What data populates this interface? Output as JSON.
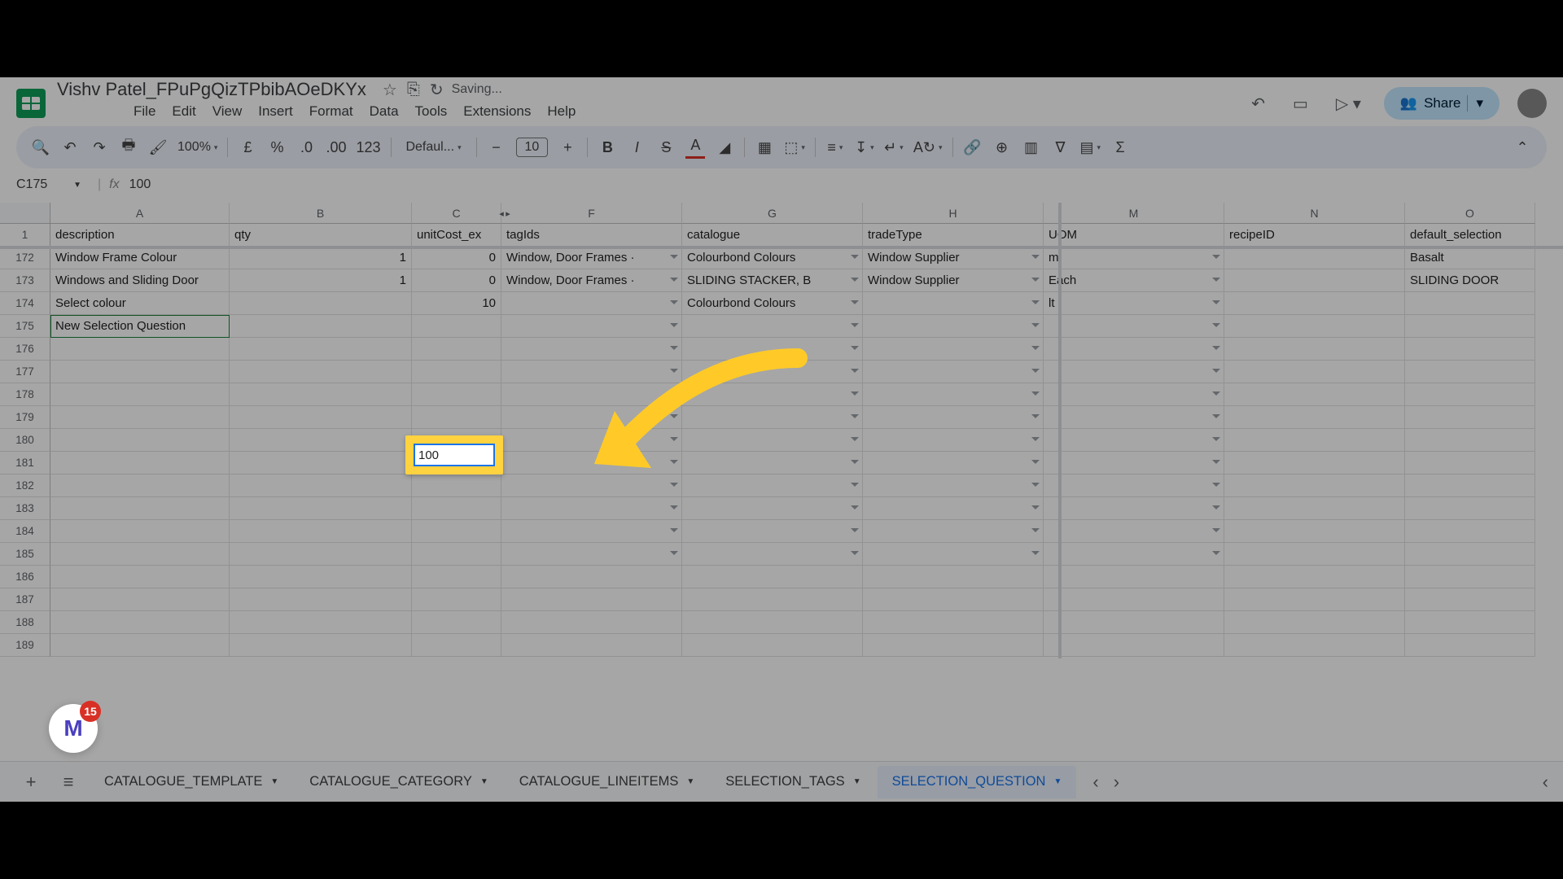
{
  "doc": {
    "title": "Vishv Patel_FPuPgQizTPbibAOeDKYx",
    "saving": "Saving...",
    "share": "Share"
  },
  "menu": [
    "File",
    "Edit",
    "View",
    "Insert",
    "Format",
    "Data",
    "Tools",
    "Extensions",
    "Help"
  ],
  "toolbar": {
    "zoom": "100%",
    "currency": "£",
    "font": "Defaul...",
    "size": "10"
  },
  "namebox": "C175",
  "formula": "100",
  "columns": {
    "A": "description",
    "B": "qty",
    "C": "unitCost_ex",
    "F": "tagIds",
    "G": "catalogue",
    "H": "tradeType",
    "M": "UOM",
    "N": "recipeID",
    "O": "default_selection"
  },
  "col_letters": [
    "A",
    "B",
    "C",
    "F",
    "G",
    "H",
    "M",
    "N",
    "O"
  ],
  "row_numbers": [
    "1",
    "172",
    "173",
    "174",
    "175",
    "176",
    "177",
    "178",
    "179",
    "180",
    "181",
    "182",
    "183",
    "184",
    "185",
    "186",
    "187",
    "188",
    "189"
  ],
  "rows": [
    {
      "A": "Window Frame Colour",
      "B": "1",
      "C": "0",
      "F": "Window, Door Frames ·",
      "G": "Colourbond Colours",
      "H": "Window Supplier",
      "M": "m",
      "N": "",
      "O": "Basalt"
    },
    {
      "A": "Windows and Sliding Door",
      "B": "1",
      "C": "0",
      "F": "Window, Door Frames ·",
      "G": "SLIDING STACKER, B",
      "H": "Window Supplier",
      "M": "Each",
      "N": "",
      "O": "SLIDING DOOR"
    },
    {
      "A": "Select colour",
      "B": "",
      "C": "10",
      "F": "",
      "G": "Colourbond Colours",
      "H": "",
      "M": "lt",
      "N": "",
      "O": ""
    },
    {
      "A": "New Selection Question",
      "B": "",
      "C": "",
      "F": "",
      "G": "",
      "H": "",
      "M": "",
      "N": "",
      "O": ""
    }
  ],
  "edit_value": "100",
  "sheets": [
    {
      "name": "CATALOGUE_TEMPLATE",
      "active": false
    },
    {
      "name": "CATALOGUE_CATEGORY",
      "active": false
    },
    {
      "name": "CATALOGUE_LINEITEMS",
      "active": false
    },
    {
      "name": "SELECTION_TAGS",
      "active": false
    },
    {
      "name": "SELECTION_QUESTION",
      "active": true
    }
  ],
  "badge_count": "15"
}
